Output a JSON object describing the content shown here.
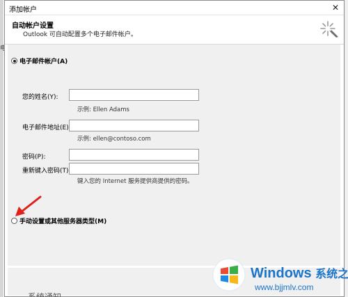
{
  "window": {
    "title": "添加帐户",
    "close_glyph": "✕"
  },
  "header": {
    "title": "自动帐户设置",
    "subtitle": "Outlook 可自动配置多个电子邮件帐户。"
  },
  "email_account": {
    "radio_label": "电子邮件帐户(A)",
    "selected": true,
    "fields": [
      {
        "label": "您的姓名(Y):",
        "value": "",
        "hint": "示例: Ellen Adams"
      },
      {
        "label": "电子邮件地址(E):",
        "value": "",
        "hint": "示例: ellen@contoso.com"
      },
      {
        "label": "密码(P):",
        "value": ""
      },
      {
        "label": "重新键入密码(T):",
        "value": "",
        "hint": "键入您的 Internet 服务提供商提供的密码。"
      }
    ]
  },
  "manual_setup": {
    "radio_label": "手动设置或其他服务器类型(M)",
    "selected": false
  },
  "background": {
    "edge_char": "电",
    "bottom_text": "系统通知"
  },
  "watermark": {
    "brand": "Windows",
    "brand_cn": "系统之家",
    "url": "www.bjjmlv.com"
  },
  "colors": {
    "arrow": "#e0201a",
    "watermark_blue": "#1a74c9"
  }
}
